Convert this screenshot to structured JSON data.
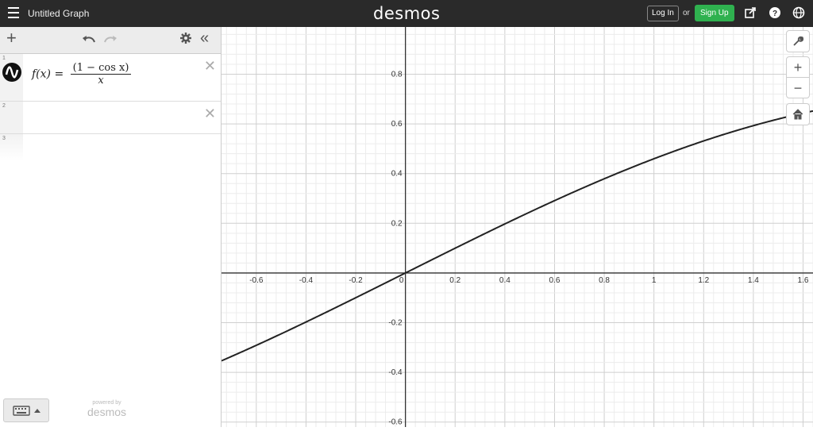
{
  "topbar": {
    "title": "Untitled Graph",
    "logo": "desmos",
    "login_label": "Log In",
    "or_label": "or",
    "signup_label": "Sign Up",
    "icons": [
      "share-icon",
      "help-icon",
      "globe-icon"
    ]
  },
  "expressions": [
    {
      "number": "1",
      "lhs": "f(x) =",
      "numerator": "(1 − cos x)",
      "denominator": "x",
      "color": "#000000"
    },
    {
      "number": "2"
    },
    {
      "number": "3"
    }
  ],
  "footer": {
    "powered_by": "powered by",
    "logo": "desmos"
  },
  "graph": {
    "x_ticks": [
      "-0.6",
      "-0.4",
      "-0.2",
      "0",
      "0.2",
      "0.4",
      "0.6",
      "0.8",
      "1",
      "1.2",
      "1.4",
      "1.6"
    ],
    "y_ticks": [
      "0.8",
      "0.6",
      "0.4",
      "0.2",
      "-0.2",
      "-0.4",
      "-0.6"
    ],
    "xlim": [
      -0.74,
      1.64
    ],
    "ylim": [
      -0.62,
      0.99
    ],
    "curve_color": "#222222"
  }
}
